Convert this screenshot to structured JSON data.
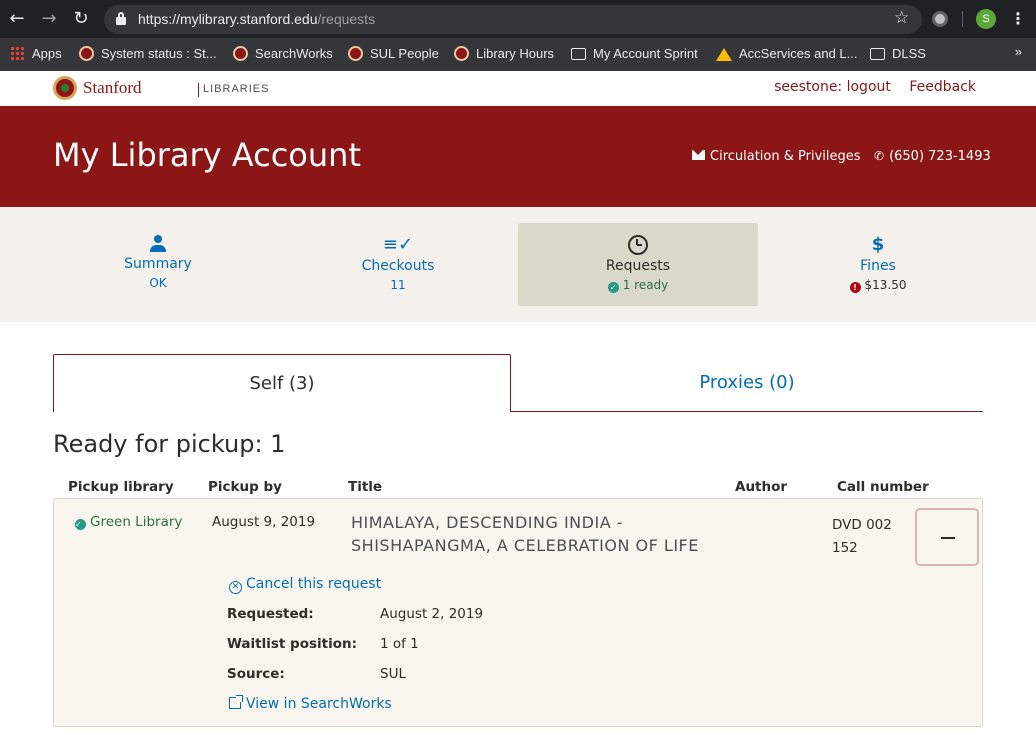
{
  "browser": {
    "url_host": "https://mylibrary.stanford.edu",
    "url_path": "/requests",
    "profile_initial": "S",
    "bookmarks": [
      {
        "label": "Apps",
        "icon": "apps-grid-icon"
      },
      {
        "label": "System status : St...",
        "icon": "stanford-seal-icon"
      },
      {
        "label": "SearchWorks",
        "icon": "stanford-seal-icon"
      },
      {
        "label": "SUL People",
        "icon": "stanford-seal-icon"
      },
      {
        "label": "Library Hours",
        "icon": "stanford-seal-icon"
      },
      {
        "label": "My Account Sprint",
        "icon": "folder-icon"
      },
      {
        "label": "AccServices and L...",
        "icon": "google-drive-icon"
      },
      {
        "label": "DLSS",
        "icon": "folder-icon"
      }
    ],
    "more_label": "»"
  },
  "header": {
    "logo_word": "Stanford",
    "logo_sub": "LIBRARIES",
    "user_logout": "seestone: logout",
    "feedback": "Feedback",
    "page_title": "My Library Account",
    "contact_link": "Circulation & Privileges",
    "phone": "(650) 723-1493"
  },
  "nav": {
    "summary": {
      "label": "Summary",
      "sub": "OK"
    },
    "checkouts": {
      "label": "Checkouts",
      "sub": "11"
    },
    "requests": {
      "label": "Requests",
      "sub": "1 ready"
    },
    "fines": {
      "label": "Fines",
      "sub": "$13.50"
    }
  },
  "tabs": {
    "self": "Self (3)",
    "proxies": "Proxies (0)"
  },
  "ready": {
    "heading": "Ready for pickup: 1",
    "columns": {
      "pickup_library": "Pickup library",
      "pickup_by": "Pickup by",
      "title": "Title",
      "author": "Author",
      "call_number": "Call number"
    },
    "item": {
      "library": "Green Library",
      "pickup_by": "August 9, 2019",
      "title_line1": "HIMALAYA, DESCENDING INDIA -",
      "title_line2": "SHISHAPANGMA, A CELEBRATION OF LIFE",
      "author": "",
      "call_line1": "DVD 002",
      "call_line2": "152",
      "cancel_label": "Cancel this request",
      "requested_label": "Requested:",
      "requested_value": "August 2, 2019",
      "waitlist_label": "Waitlist position:",
      "waitlist_value": "1 of 1",
      "source_label": "Source:",
      "source_value": "SUL",
      "view_label": "View in SearchWorks"
    }
  },
  "colors": {
    "cardinal": "#8c1515",
    "link": "#006cb8",
    "ok_green": "#279989",
    "error_red": "#b1040e"
  }
}
